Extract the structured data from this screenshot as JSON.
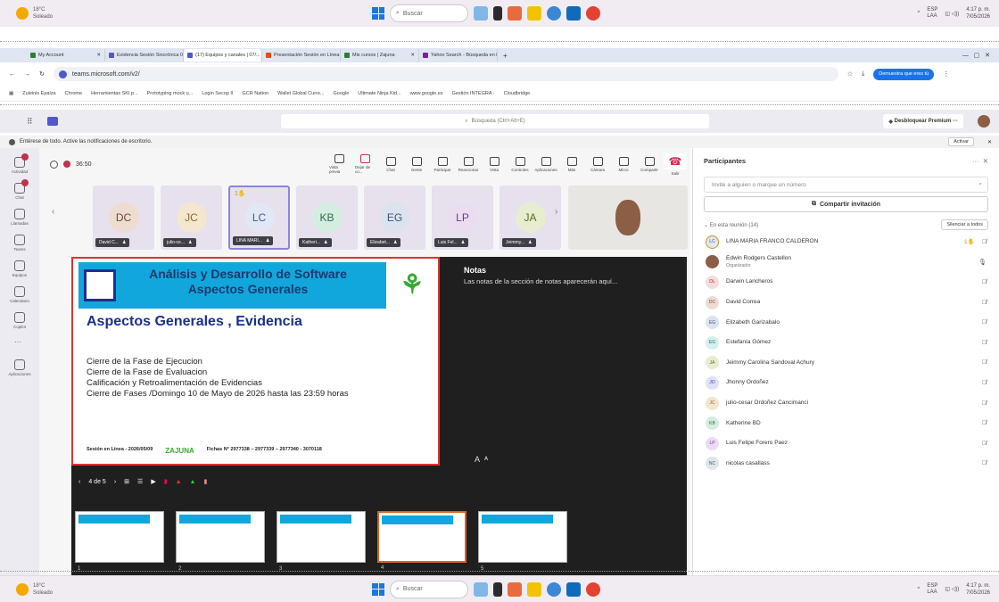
{
  "taskbar": {
    "weather_temp": "18°C",
    "weather_desc": "Soleado",
    "search_placeholder": "Buscar",
    "lang": "ESP",
    "lang_sub": "LAA",
    "time": "4:17 p. m.",
    "date": "7/05/2026"
  },
  "browser": {
    "tabs": [
      {
        "label": "My Account",
        "color": "#2e7d32",
        "active": false
      },
      {
        "label": "Evidencia Sesión Sincrónica 07/...",
        "color": "#5059c9",
        "active": false
      },
      {
        "label": "(17) Equipos y canales | 07/...",
        "color": "#5059c9",
        "active": true
      },
      {
        "label": "Presentación Sesión en Línea | ...",
        "color": "#e64a19",
        "active": false
      },
      {
        "label": "Mis cursos | Zajuna",
        "color": "#2e7d32",
        "active": false
      },
      {
        "label": "Yahoo Search - Búsqueda en la ...",
        "color": "#7b1fa2",
        "active": false
      }
    ],
    "url": "teams.microsoft.com/v2/",
    "promo": "Demuestra que eres tú",
    "bookmarks": [
      "Zuleinis Epalza",
      "Chrome",
      "Herramientas SKI p...",
      "Prototyping mock u...",
      "Login Secop II",
      "GCR Nation",
      "Wallet Global Curre...",
      "Google",
      "Ultimate Ninja Kid...",
      "www.google.es",
      "Gestión INTEGRA ·",
      "Cloudbridge"
    ]
  },
  "teams": {
    "search_placeholder": "Búsqueda (Ctrl+Alt+E)",
    "premium": "Desbloquear Premium",
    "notif_text": "Entérese de todo. Active las notificaciones de escritorio.",
    "notif_btn": "Activar",
    "rail": [
      "Actividad",
      "Chat",
      "Llamadas",
      "Teams",
      "Equipos",
      "Calendario",
      "Copilot",
      "",
      "Aplicaciones"
    ],
    "timer": "36:50",
    "controls": [
      "Vista previa",
      "Dejar de co...",
      "Chat",
      "Gente",
      "Participar",
      "Reaccionar",
      "Vista",
      "Controles",
      "Aplicaciones",
      "Más",
      "Cámara",
      "Micro",
      "Compartir",
      "Salir"
    ]
  },
  "tiles": [
    {
      "initials": "DC",
      "tag": "David C...",
      "bg": "#efdcd1",
      "fg": "#6b4a3a",
      "selected": false
    },
    {
      "initials": "JC",
      "tag": "julio-ce...",
      "bg": "#f4e6cf",
      "fg": "#8a6a2b",
      "selected": false
    },
    {
      "initials": "LC",
      "tag": "LINA MARI...",
      "bg": "#e1e7f4",
      "fg": "#3c5a94",
      "selected": true
    },
    {
      "initials": "KB",
      "tag": "Katheri...",
      "bg": "#d5ede0",
      "fg": "#2c6e49",
      "selected": false
    },
    {
      "initials": "EG",
      "tag": "Elizabet...",
      "bg": "#dbe3ee",
      "fg": "#3a5677",
      "selected": false
    },
    {
      "initials": "LP",
      "tag": "Luis Fel...",
      "bg": "#ebdcf2",
      "fg": "#6b3d8a",
      "selected": false
    },
    {
      "initials": "JA",
      "tag": "Jeimmy...",
      "bg": "#e7edcf",
      "fg": "#5b6b24",
      "selected": false
    }
  ],
  "raise_hand_count": "1",
  "slide": {
    "banner_title_1": "Análisis y Desarrollo de Software",
    "banner_title_2": "Aspectos Generales",
    "heading": "Aspectos Generales , Evidencia",
    "lines": [
      "Cierre de la Fase de Ejecucion",
      "Cierre de la Fase de Evaluacion",
      "Calificación y Retroalimentación de Evidencias",
      "Cierre de Fases /Domingo 10 de Mayo de 2026 hasta las 23:59 horas"
    ],
    "footer_left": "Sesión en Línea - 2026/05/09",
    "footer_logo": "ZAJUNA",
    "footer_right": "Fichas N° 2977338 – 2977339 – 2977340 - 3070118"
  },
  "notes": {
    "title": "Notas",
    "body": "Las notas de la sección de notas aparecerán aquí..."
  },
  "slide_nav": "4 de 5",
  "thumbs": [
    "1",
    "2",
    "3",
    "4",
    "5"
  ],
  "panel": {
    "title": "Participantes",
    "invite_placeholder": "Invite a alguien o marque un número",
    "share": "Compartir invitación",
    "section": "En esta reunión (14)",
    "mute_all": "Silenciar a todos",
    "people": [
      {
        "initials": "LC",
        "name": "LINA MARIA FRANCO CALDERON",
        "role": "",
        "bg": "#e1e7f4",
        "fg": "#3c5a94"
      },
      {
        "initials": "",
        "name": "Edwin Rodgers Castellon",
        "role": "Organizador",
        "bg": "#8b5e45",
        "fg": "#fff"
      },
      {
        "initials": "DL",
        "name": "Darwin Lancheros",
        "role": "",
        "bg": "#f6dcdc",
        "fg": "#a33"
      },
      {
        "initials": "DC",
        "name": "David Correa",
        "role": "",
        "bg": "#efdcd1",
        "fg": "#6b4a3a"
      },
      {
        "initials": "EG",
        "name": "Elizabeth Garizabalo",
        "role": "",
        "bg": "#dbe3ee",
        "fg": "#3a5677"
      },
      {
        "initials": "EG",
        "name": "Estefanía Gómez",
        "role": "",
        "bg": "#d6efef",
        "fg": "#2a6e6e"
      },
      {
        "initials": "JA",
        "name": "Jeimmy Carolina Sandoval Achury",
        "role": "",
        "bg": "#e7edcf",
        "fg": "#5b6b24"
      },
      {
        "initials": "JO",
        "name": "Jhonny Ordoñez",
        "role": "",
        "bg": "#dfe1f6",
        "fg": "#3a3f94"
      },
      {
        "initials": "JC",
        "name": "julio-cesar Ordoñez Cancimanci",
        "role": "",
        "bg": "#f4e6cf",
        "fg": "#8a6a2b"
      },
      {
        "initials": "KB",
        "name": "Katherine BD",
        "role": "",
        "bg": "#d5ede0",
        "fg": "#2c6e49"
      },
      {
        "initials": "LP",
        "name": "Luis Felipe Forero Paez",
        "role": "",
        "bg": "#ebdcf2",
        "fg": "#6b3d8a"
      },
      {
        "initials": "NC",
        "name": "nicolas casallass",
        "role": "",
        "bg": "#dde6ea",
        "fg": "#3f5966"
      }
    ]
  }
}
